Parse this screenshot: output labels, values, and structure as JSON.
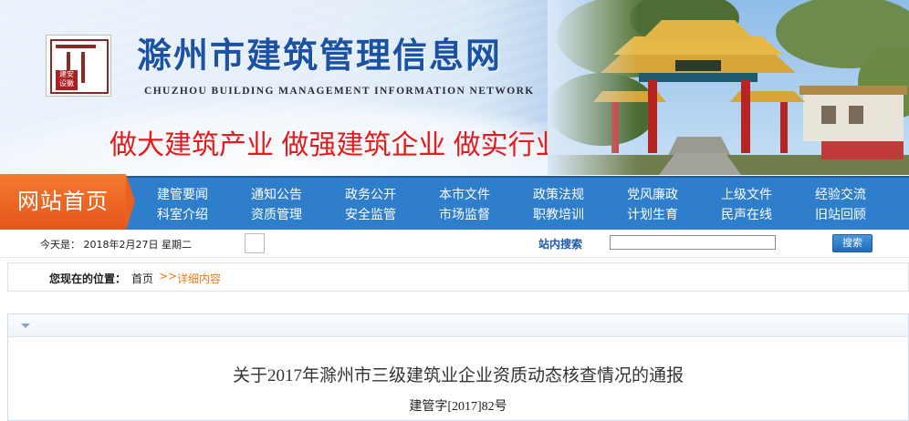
{
  "header": {
    "title": "滁州市建筑管理信息网",
    "subtitle": "CHUZHOU BUILDING MANAGEMENT INFORMATION NETWORK",
    "slogan": "做大建筑产业 做强建筑企业 做实行业管理",
    "logo_text": "建安设徽"
  },
  "nav": {
    "home_label": "网站首页",
    "row1": [
      "建管要闻",
      "通知公告",
      "政务公开",
      "本市文件",
      "政策法规",
      "党风廉政",
      "上级文件",
      "经验交流"
    ],
    "row2": [
      "科室介绍",
      "资质管理",
      "安全监管",
      "市场监督",
      "职教培训",
      "计划生育",
      "民声在线",
      "旧站回顾"
    ]
  },
  "infobar": {
    "date_text": "今天是： 2018年2月27日 星期二",
    "search_label": "站内搜索",
    "search_value": "",
    "search_button": "搜索"
  },
  "breadcrumb": {
    "label": "您现在的位置：",
    "home": "首页",
    "separator": ">>",
    "current": "详细内容"
  },
  "article": {
    "title": "关于2017年滁州市三级建筑业企业资质动态核查情况的通报",
    "doc_number": "建管字[2017]82号"
  }
}
